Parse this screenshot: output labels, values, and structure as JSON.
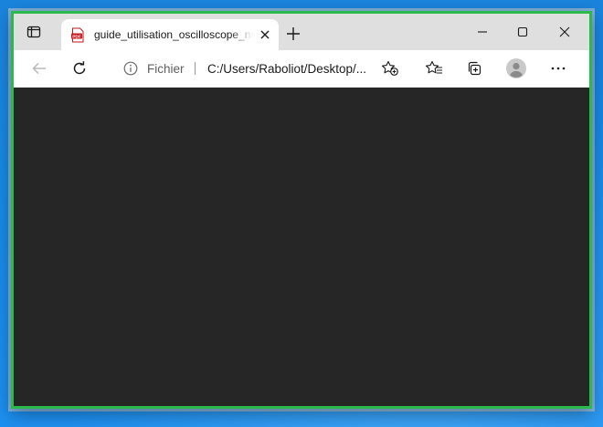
{
  "browser": {
    "tab": {
      "title": "guide_utilisation_oscilloscope_numerique.pdf",
      "icon": "pdf-file-icon"
    },
    "address_bar": {
      "scheme_label": "Fichier",
      "url": "C:/Users/Raboliot/Desktop/..."
    },
    "icons": {
      "tab_actions": "tab-actions-icon",
      "close_tab": "close-icon",
      "new_tab": "plus-icon",
      "minimize": "minimize-icon",
      "maximize": "maximize-icon",
      "close_window": "close-icon",
      "back": "back-arrow-icon",
      "refresh": "refresh-icon",
      "info": "info-icon",
      "add_favorite": "star-plus-icon",
      "favorites": "favorites-icon",
      "collections": "collections-icon",
      "profile": "profile-avatar-icon",
      "more": "more-icon"
    }
  },
  "colors": {
    "window_border": "#2db84c",
    "content_background": "#262626",
    "desktop_background": "#178ae6"
  }
}
